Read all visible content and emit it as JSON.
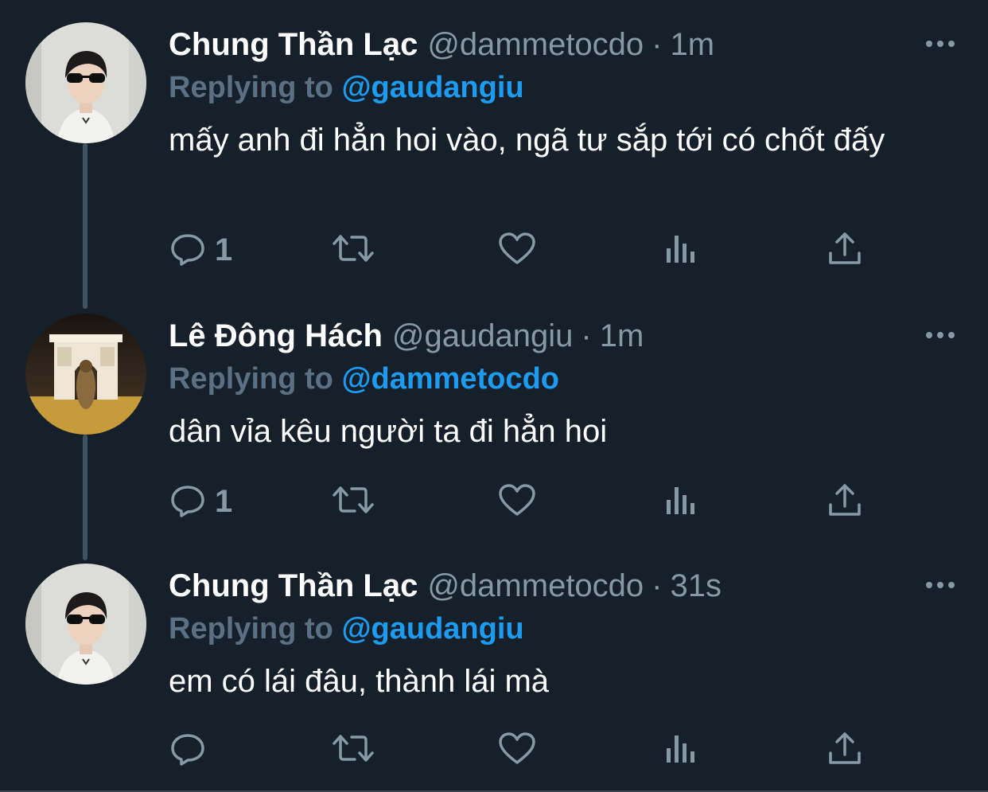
{
  "tweets": [
    {
      "name": "Chung Thần Lạc",
      "handle": "@dammetocdo",
      "separator": "·",
      "time": "1m",
      "reply_label": "Replying to",
      "reply_to": "@gaudangiu",
      "text": "mấy anh đi hẳn hoi vào, ngã tư sắp tới có chốt đấy",
      "reply_count": "1",
      "avatar": "avatar-boy-sunglasses"
    },
    {
      "name": "Lê Đông Hách",
      "handle": "@gaudangiu",
      "separator": "·",
      "time": "1m",
      "reply_label": "Replying to",
      "reply_to": "@dammetocdo",
      "text": "dân vỉa kêu người ta đi hẳn hoi",
      "reply_count": "1",
      "avatar": "avatar-arc-de-triomphe"
    },
    {
      "name": "Chung Thần Lạc",
      "handle": "@dammetocdo",
      "separator": "·",
      "time": "31s",
      "reply_label": "Replying to",
      "reply_to": "@gaudangiu",
      "text": "em có lái đâu, thành lái mà",
      "reply_count": "",
      "avatar": "avatar-boy-sunglasses"
    }
  ],
  "icons": {
    "reply": "comment-icon",
    "retweet": "retweet-icon",
    "like": "heart-icon",
    "analytics": "analytics-icon",
    "share": "share-icon",
    "more": "more-icon"
  },
  "colors": {
    "background": "#15202b",
    "name": "#ffffff",
    "secondary": "#8899a6",
    "link": "#1d9bf0",
    "thread_line": "#3d5466"
  }
}
